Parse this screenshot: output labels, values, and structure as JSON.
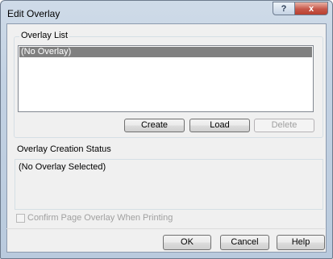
{
  "window": {
    "title": "Edit Overlay",
    "help_glyph": "?",
    "close_glyph": "x"
  },
  "overlay_list": {
    "group_label": "Overlay List",
    "items": [
      "(No Overlay)"
    ],
    "selected_index": 0,
    "buttons": {
      "create": "Create",
      "load": "Load",
      "delete": "Delete"
    }
  },
  "status": {
    "label": "Overlay Creation Status",
    "text": "(No Overlay Selected)"
  },
  "confirm_checkbox": {
    "label": "Confirm Page Overlay When Printing",
    "checked": false,
    "enabled": false
  },
  "footer": {
    "ok": "OK",
    "cancel": "Cancel",
    "help": "Help"
  }
}
